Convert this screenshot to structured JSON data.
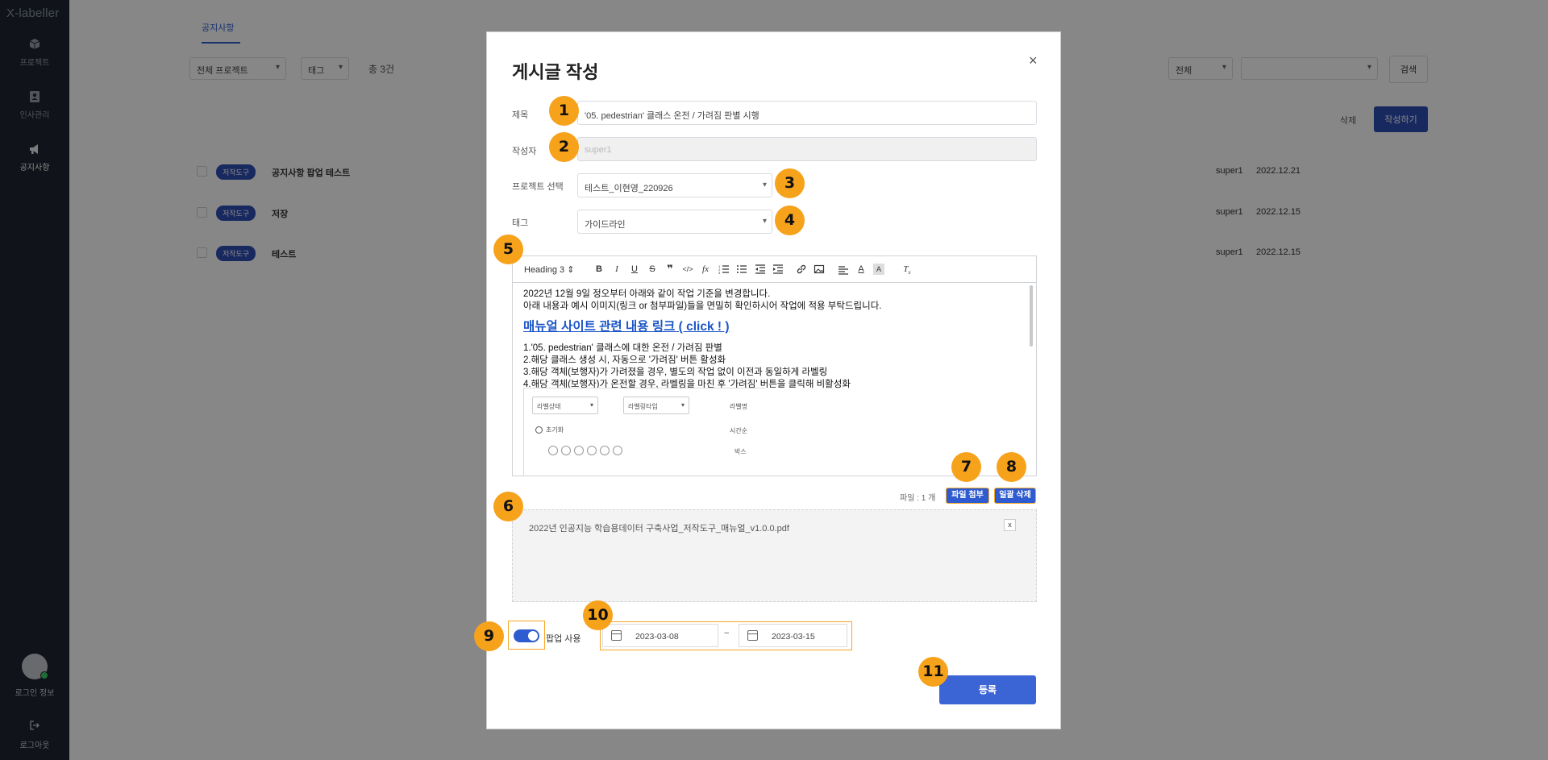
{
  "sidebar": {
    "logo": "X-labeller",
    "items": [
      {
        "label": "프로젝트",
        "icon": "cube-icon"
      },
      {
        "label": "인사관리",
        "icon": "person-badge-icon"
      },
      {
        "label": "공지사항",
        "icon": "megaphone-icon"
      }
    ],
    "login_label": "로그인 정보",
    "logout_label": "로그아웃"
  },
  "background": {
    "tab": "공지사항",
    "project_filter": "전체 프로젝트",
    "tag_filter": "태그",
    "total": "총 3건",
    "search_scope": "전체",
    "search_button": "검색",
    "delete_button": "삭제",
    "write_button": "작성하기",
    "rows": [
      {
        "badge": "저작도구",
        "title": "공지사항 팝업 테스트",
        "author": "super1",
        "date": "2022.12.21"
      },
      {
        "badge": "저작도구",
        "title": "저장",
        "author": "super1",
        "date": "2022.12.15"
      },
      {
        "badge": "저작도구",
        "title": "테스트",
        "author": "super1",
        "date": "2022.12.15"
      }
    ]
  },
  "modal": {
    "title": "게시글 작성",
    "close": "×",
    "fields": {
      "title_label": "제목",
      "title_value": "'05. pedestrian' 클래스 온전 / 가려짐 판별 시행",
      "author_label": "작성자",
      "author_value": "super1",
      "project_label": "프로젝트 선택",
      "project_value": "테스트_이현영_220926",
      "tag_label": "태그",
      "tag_value": "가이드라인"
    },
    "editor": {
      "heading": "Heading 3 ⇕",
      "line1": "2022년 12월 9일 정오부터 아래와 같이 작업 기준을 변경합니다.",
      "line2": "아래 내용과 예시 이미지(링크 or 첨부파일)들을 면밀히 확인하시어 작업에 적용 부탁드립니다.",
      "link": "매뉴얼 사이트 관련 내용 링크 ( click ! )",
      "item1": "1.'05. pedestrian' 클래스에 대한 온전 / 가려짐 판별",
      "item2": "2.해당 클래스 생성 시, 자동으로 '가려짐' 버튼 활성화",
      "item3": "3.해당 객체(보행자)가 가려졌을 경우, 별도의 작업 없이 이전과 동일하게 라벨링",
      "item4": "4.해당 객체(보행자)가 온전할 경우, 라벨링을 마친 후 '가려짐' 버튼을 클릭해 비활성화",
      "embed": {
        "select1": "라벨상태",
        "select2": "라벨링타입",
        "label3": "라벨명",
        "reset": "초기화",
        "sort": "시간순",
        "box": "박스"
      }
    },
    "files": {
      "count": "파일 : 1 개",
      "attach_button": "파일 첨부",
      "delete_all_button": "일괄 삭제",
      "items": [
        "2022년 인공지능 학습용데이터 구축사업_저작도구_매뉴얼_v1.0.0.pdf"
      ],
      "remove": "x"
    },
    "popup": {
      "label": "팝업 사용",
      "enabled": true,
      "start_date": "2023-03-08",
      "separator": "~",
      "end_date": "2023-03-15"
    },
    "submit": "등록"
  },
  "markers": [
    "1",
    "2",
    "3",
    "4",
    "5",
    "6",
    "7",
    "8",
    "9",
    "10",
    "11"
  ],
  "colors": {
    "marker": "#f7a21b",
    "primary": "#2e5bd0",
    "sidebar": "#1f2430"
  }
}
